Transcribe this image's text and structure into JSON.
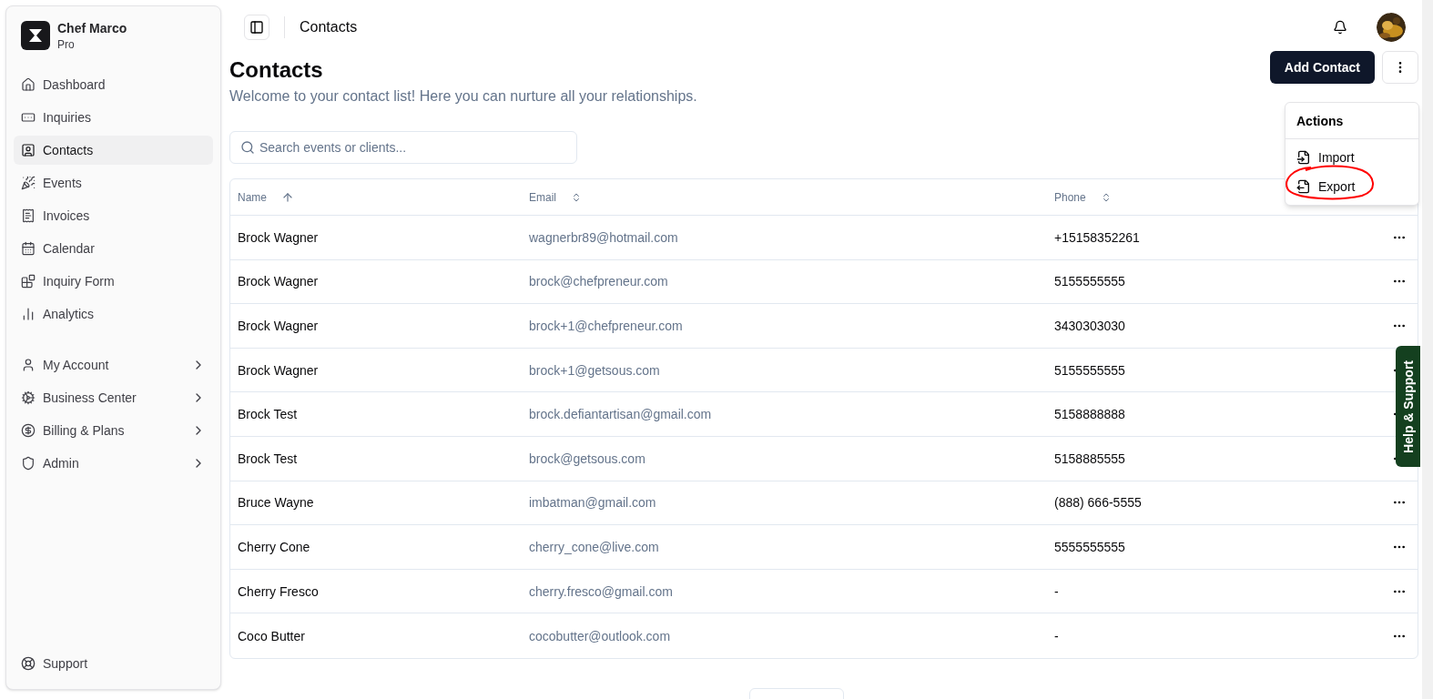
{
  "workspace": {
    "name": "Chef Marco",
    "plan": "Pro"
  },
  "sidebar": {
    "items": [
      {
        "label": "Dashboard",
        "kind": "link",
        "selected": false
      },
      {
        "label": "Inquiries",
        "kind": "link",
        "selected": false
      },
      {
        "label": "Contacts",
        "kind": "link",
        "selected": true
      },
      {
        "label": "Events",
        "kind": "link",
        "selected": false
      },
      {
        "label": "Invoices",
        "kind": "link",
        "selected": false
      },
      {
        "label": "Calendar",
        "kind": "link",
        "selected": false
      },
      {
        "label": "Inquiry Form",
        "kind": "link",
        "selected": false
      },
      {
        "label": "Analytics",
        "kind": "link",
        "selected": false
      }
    ],
    "account_items": [
      {
        "label": "My Account",
        "kind": "submenu",
        "selected": false
      },
      {
        "label": "Business Center",
        "kind": "submenu",
        "selected": false
      },
      {
        "label": "Billing & Plans",
        "kind": "submenu",
        "selected": false
      },
      {
        "label": "Admin",
        "kind": "submenu",
        "selected": false
      }
    ],
    "footer": {
      "label": "Support"
    }
  },
  "breadcrumb": "Contacts",
  "page": {
    "title": "Contacts",
    "subtitle": "Welcome to your contact list! Here you can nurture all your relationships.",
    "primary_button": "Add Contact"
  },
  "actions_menu": {
    "title": "Actions",
    "items": [
      {
        "label": "Import",
        "kind": "import",
        "circled": false
      },
      {
        "label": "Export",
        "kind": "export",
        "circled": true
      }
    ]
  },
  "search": {
    "placeholder": "Search events or clients..."
  },
  "table": {
    "columns": [
      {
        "label": "Name",
        "sorted": true
      },
      {
        "label": "Email",
        "sorted": false
      },
      {
        "label": "Phone",
        "sorted": false
      }
    ],
    "rows": [
      [
        "Brock Wagner",
        "wagnerbr89@hotmail.com",
        "+15158352261"
      ],
      [
        "Brock Wagner",
        "brock@chefpreneur.com",
        "5155555555"
      ],
      [
        "Brock Wagner",
        "brock+1@chefpreneur.com",
        "3430303030"
      ],
      [
        "Brock Wagner",
        "brock+1@getsous.com",
        "5155555555"
      ],
      [
        "Brock Test",
        "brock.defiantartisan@gmail.com",
        "5158888888"
      ],
      [
        "Brock Test",
        "brock@getsous.com",
        "5158885555"
      ],
      [
        "Bruce Wayne",
        "imbatman@gmail.com",
        "(888) 666-5555"
      ],
      [
        "Cherry Cone",
        "cherry_cone@live.com",
        "5555555555"
      ],
      [
        "Cherry Fresco",
        "cherry.fresco@gmail.com",
        "-"
      ],
      [
        "Coco Butter",
        "cocobutter@outlook.com",
        "-"
      ]
    ]
  },
  "help_tab": "Help & Support"
}
